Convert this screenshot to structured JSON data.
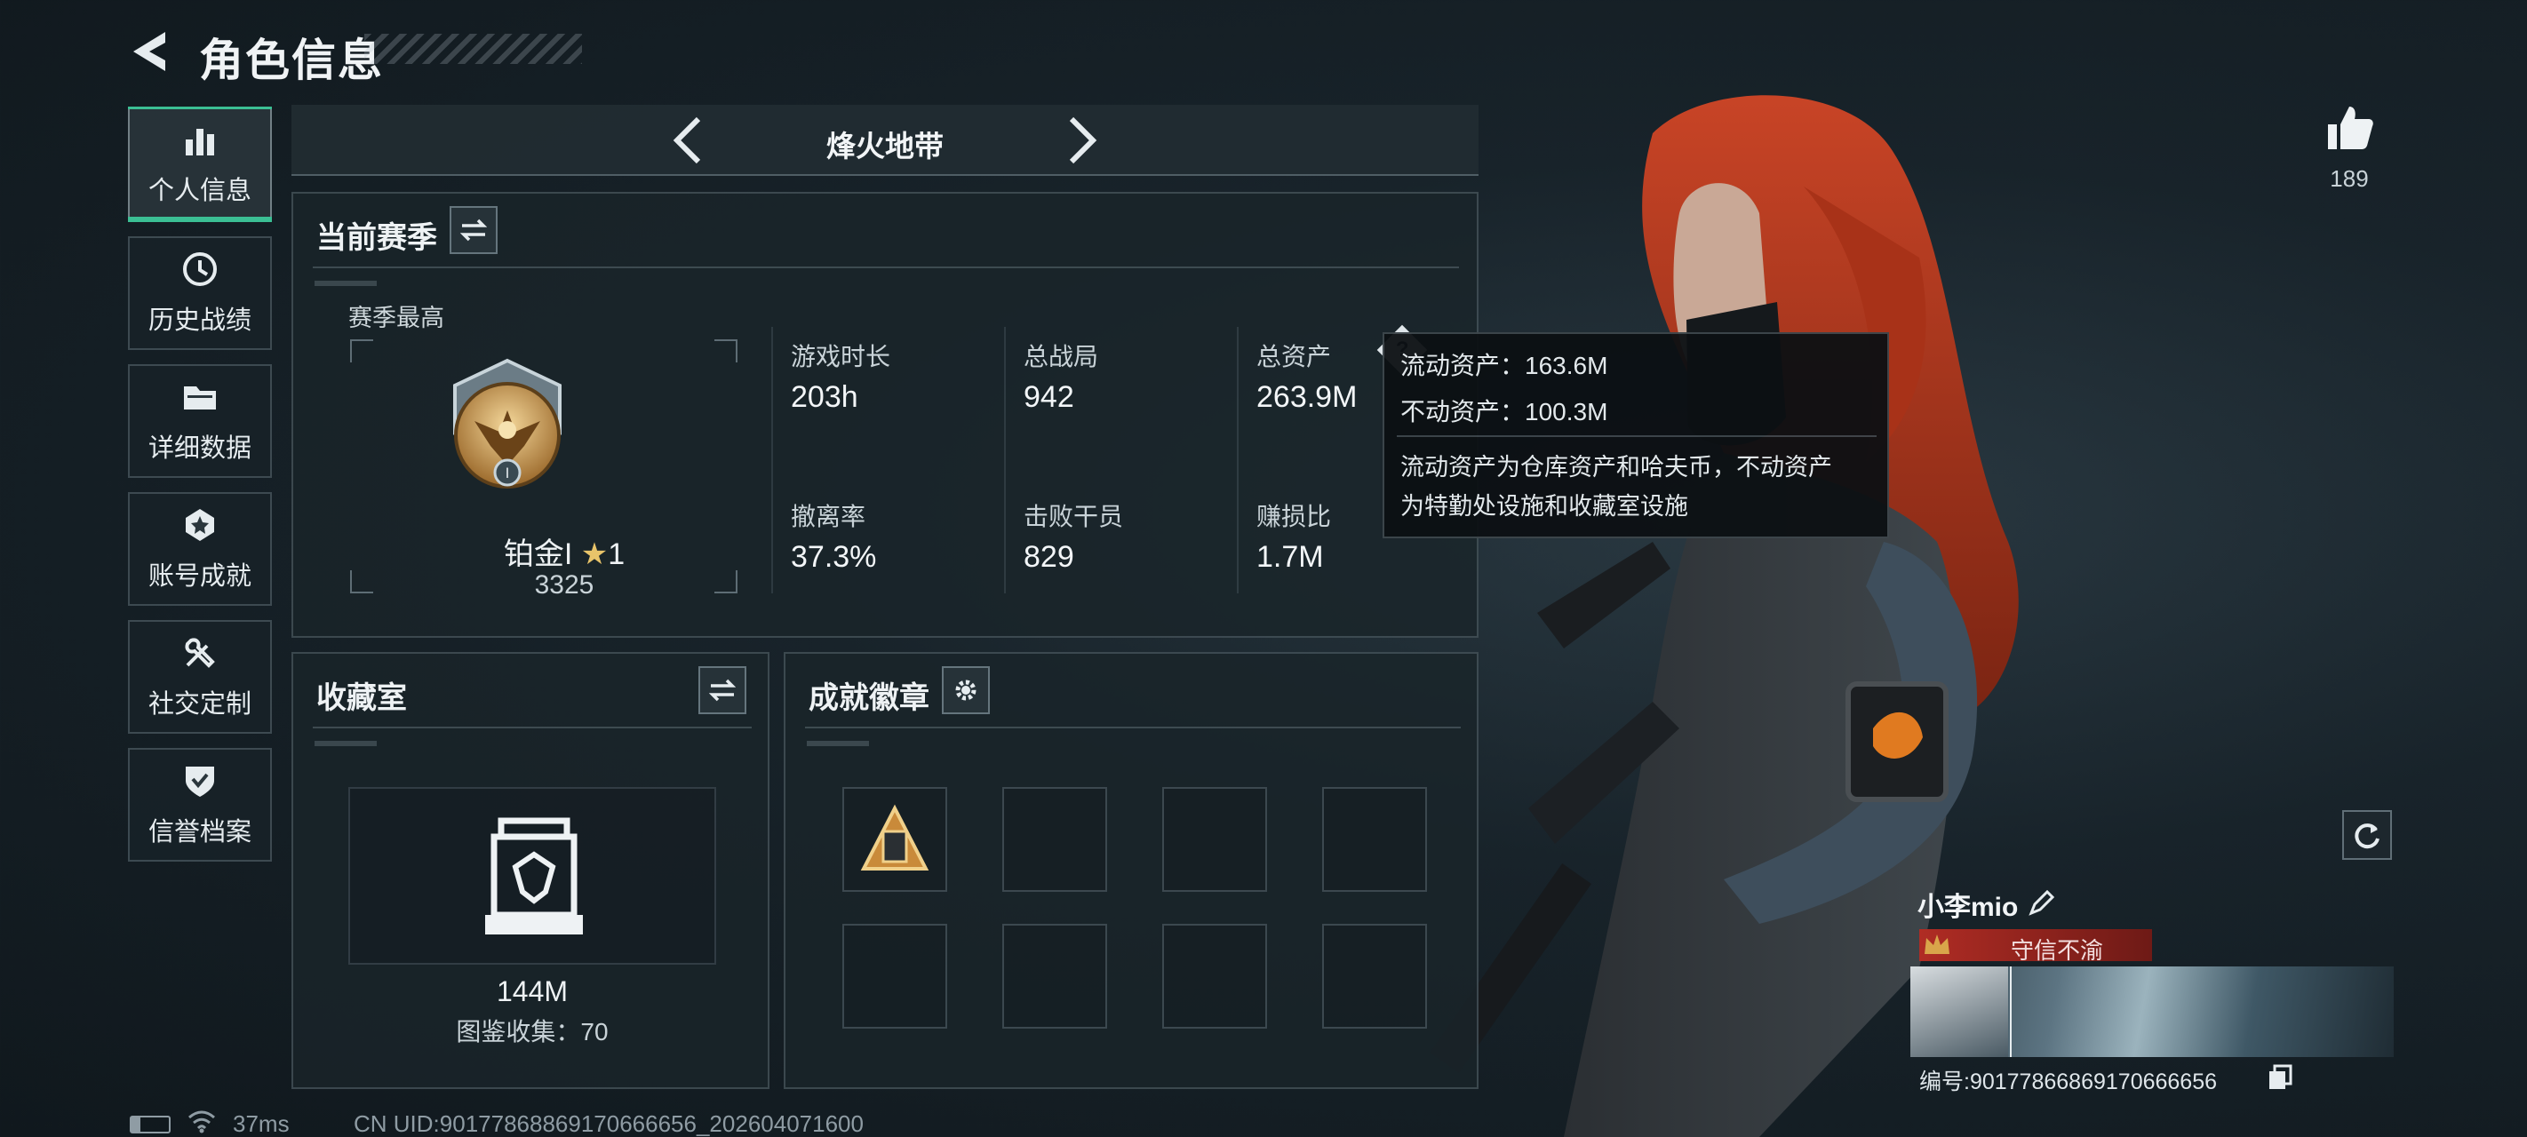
{
  "header": {
    "title": "角色信息"
  },
  "sidebar": {
    "items": [
      {
        "label": "个人信息",
        "icon": "bar-chart-icon",
        "active": true
      },
      {
        "label": "历史战绩",
        "icon": "clock-history-icon",
        "active": false
      },
      {
        "label": "详细数据",
        "icon": "folder-icon",
        "active": false
      },
      {
        "label": "账号成就",
        "icon": "achievement-badge-icon",
        "active": false
      },
      {
        "label": "社交定制",
        "icon": "tools-icon",
        "active": false
      },
      {
        "label": "信誉档案",
        "icon": "shield-check-icon",
        "active": false
      }
    ]
  },
  "mode": {
    "title": "烽火地带"
  },
  "season": {
    "title": "当前赛季",
    "best_label": "赛季最高",
    "rank_name": "铂金I",
    "rank_stars": "1",
    "rank_score": "3325",
    "stats": [
      {
        "label": "游戏时长",
        "value": "203h"
      },
      {
        "label": "总战局",
        "value": "942"
      },
      {
        "label": "总资产",
        "value": "263.9M"
      },
      {
        "label": "撤离率",
        "value": "37.3%"
      },
      {
        "label": "击败干员",
        "value": "829"
      },
      {
        "label": "赚损比",
        "value": "1.7M"
      }
    ]
  },
  "tooltip": {
    "line1": "流动资产：163.6M",
    "line2": "不动资产：100.3M",
    "desc1": "流动资产为仓库资产和哈夫币，不动资产",
    "desc2": "为特勤处设施和收藏室设施"
  },
  "collection": {
    "title": "收藏室",
    "value": "144M",
    "catalog": "图鉴收集：70"
  },
  "achievements": {
    "title": "成就徽章"
  },
  "likes": {
    "count": "189"
  },
  "player": {
    "name": "小李mio",
    "title_badge": "守信不渝",
    "id_text": "编号:9017786686917066665​6"
  },
  "status_bar": {
    "ping": "37ms",
    "uid": "CN UID:90177868869170666656_202604071600"
  },
  "colors": {
    "accent": "#3bbf94",
    "hair": "#b8341c",
    "title_badge_bg": "#8a1c1c"
  }
}
